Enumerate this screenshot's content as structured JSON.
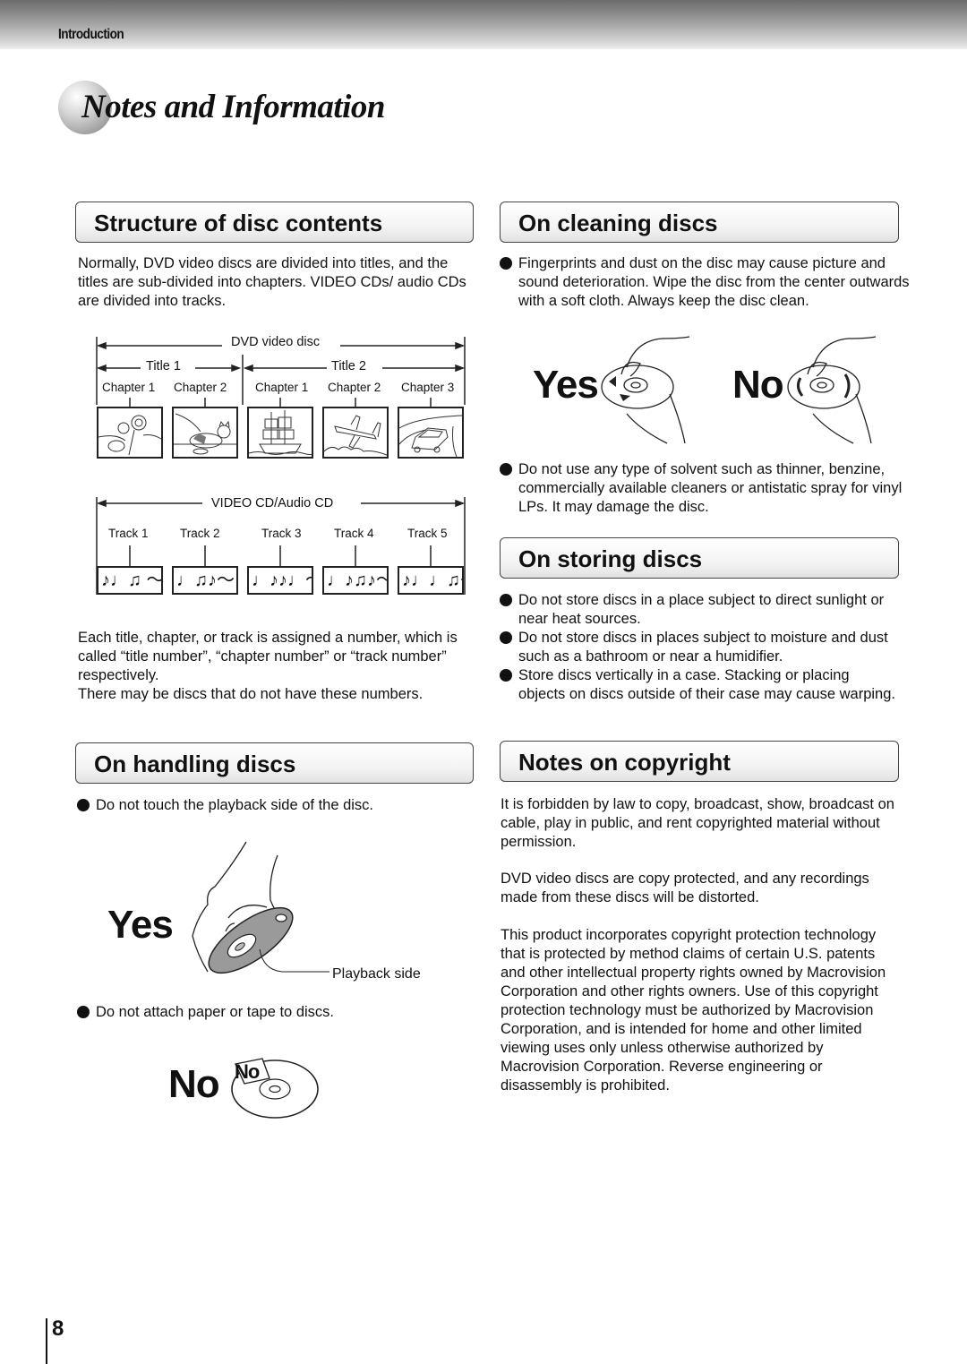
{
  "header": {
    "section": "Introduction",
    "title": "Notes and Information"
  },
  "structure": {
    "heading": "Structure of disc contents",
    "intro": "Normally, DVD video discs are divided into titles, and the titles are sub-divided into chapters. VIDEO CDs/ audio CDs are divided into tracks.",
    "dvd_diagram": {
      "label": "DVD video disc",
      "titles": [
        "Title 1",
        "Title 2"
      ],
      "chapters": [
        "Chapter 1",
        "Chapter 2",
        "Chapter 1",
        "Chapter 2",
        "Chapter 3"
      ],
      "scenes": [
        "sunflower",
        "cat",
        "sailing-ship",
        "airplane",
        "car"
      ]
    },
    "cd_diagram": {
      "label": "VIDEO CD/Audio CD",
      "tracks": [
        "Track 1",
        "Track 2",
        "Track 3",
        "Track 4",
        "Track 5"
      ],
      "notes": [
        "♪♩♫ ～",
        "♩♫♪～",
        "♩♪♪♩～",
        "♩♪♫♪～",
        "♪♩♩♫～"
      ]
    },
    "numbering_text": "Each title, chapter, or track is assigned a number, which is called “title number”, “chapter number” or “track number” respectively.",
    "note_text": "There may be discs that do not have these numbers."
  },
  "handling": {
    "heading": "On handling discs",
    "bullet1": "Do not touch the playback side of the disc.",
    "yes_label": "Yes",
    "playback_label": "Playback side",
    "bullet2": "Do not attach paper or tape to discs.",
    "no_label": "No",
    "sticker_label": "No"
  },
  "cleaning": {
    "heading": "On cleaning discs",
    "bullet1": "Fingerprints and dust on the disc may cause picture and sound deterioration. Wipe the disc from the center outwards with a soft cloth. Always keep the disc clean.",
    "yes_label": "Yes",
    "no_label": "No",
    "bullet2": "Do not use any type of solvent such as thinner, benzine, commercially available cleaners or antistatic spray for vinyl LPs. It may damage the disc."
  },
  "storing": {
    "heading": "On storing discs",
    "bullets": [
      "Do not store discs in a place subject to direct sunlight or near heat sources.",
      "Do not store discs in places subject to moisture and dust such as a bathroom or near a humidifier.",
      "Store discs vertically in a case. Stacking or placing objects on discs outside of their case may cause warping."
    ]
  },
  "copyright": {
    "heading": "Notes on copyright",
    "para1": "It is forbidden by law to copy, broadcast, show, broadcast on cable, play in public, and rent copyrighted material without permission.",
    "para2": "DVD video discs are copy protected, and any recordings made from these discs will be distorted.",
    "para3": "This product incorporates copyright protection technology that is protected by method claims of certain U.S. patents and other intellectual property rights owned by Macrovision Corporation and other rights owners. Use of this copyright protection technology must be authorized by Macrovision Corporation, and is intended for home and other limited viewing uses only unless otherwise authorized by Macrovision Corporation. Reverse engineering or disassembly is prohibited."
  },
  "footer": {
    "page_number": "8"
  }
}
